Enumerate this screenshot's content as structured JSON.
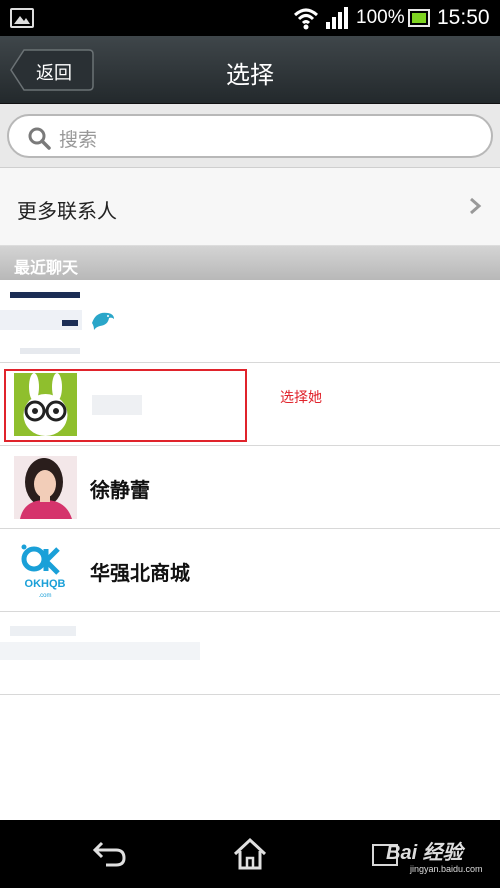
{
  "status_bar": {
    "battery_percent": "100%",
    "battery_level": 1.0,
    "time": "15:50",
    "icons": [
      "gallery-icon",
      "wifi-icon",
      "signal-icon",
      "battery-icon"
    ]
  },
  "header": {
    "back_label": "返回",
    "title": "选择"
  },
  "search": {
    "placeholder": "搜索"
  },
  "more_contacts": {
    "label": "更多联系人"
  },
  "recent": {
    "section_title": "最近聊天",
    "items": [
      {
        "name": "",
        "avatar": "blurred",
        "extra_icon": "dolphin-icon"
      },
      {
        "name": "",
        "avatar": "green-bunny-avatar",
        "highlighted": true
      },
      {
        "name": "徐静蕾",
        "avatar": "woman-photo-avatar"
      },
      {
        "name": "华强北商城",
        "avatar": "okhqb-logo-avatar"
      },
      {
        "name": "",
        "avatar": "blurred"
      }
    ]
  },
  "annotation": {
    "note": "选择她"
  },
  "nav": {
    "icons": [
      "back-icon",
      "home-icon",
      "recent-apps-icon"
    ]
  },
  "watermark": {
    "brand": "Bai 经验",
    "url": "jingyan.baidu.com"
  },
  "colors": {
    "title_bar": "#2e3539",
    "annotation_red": "#e0232b",
    "section_header": "#c6c6c6",
    "battery_green": "#7ed321"
  }
}
